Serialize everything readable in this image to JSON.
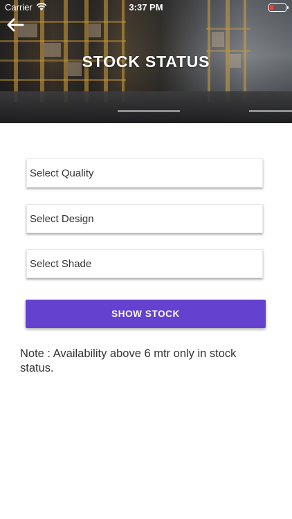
{
  "status_bar": {
    "carrier": "Carrier",
    "time": "3:37 PM",
    "battery_color": "#ff3b30"
  },
  "header": {
    "back_icon": "arrow-left-icon",
    "title": "STOCK STATUS"
  },
  "form": {
    "quality_placeholder": "Select Quality",
    "design_placeholder": "Select Design",
    "shade_placeholder": "Select Shade",
    "submit_label": "SHOW STOCK",
    "submit_color": "#6441cf"
  },
  "note": {
    "text": "Note :  Availability above 6 mtr only in stock status."
  }
}
